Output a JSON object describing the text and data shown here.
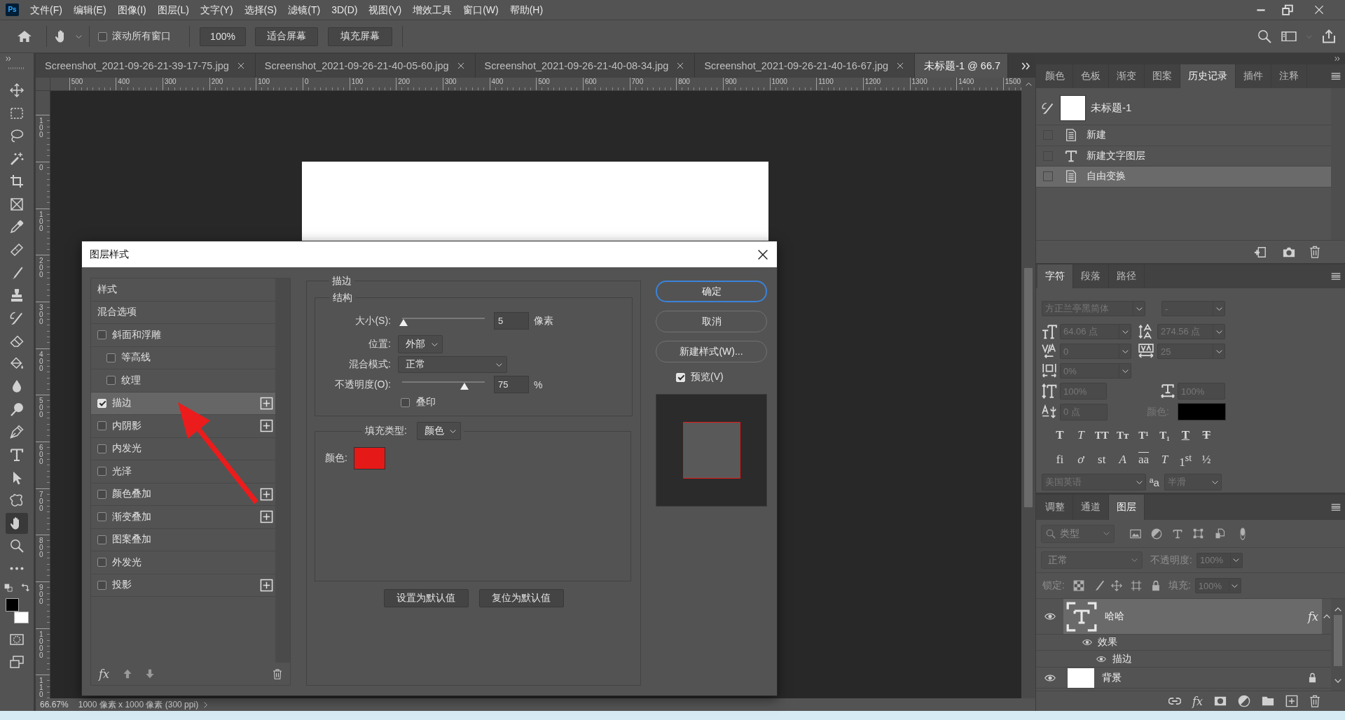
{
  "menu_bar": {
    "logo": "Ps",
    "items": [
      "文件(F)",
      "编辑(E)",
      "图像(I)",
      "图层(L)",
      "文字(Y)",
      "选择(S)",
      "滤镜(T)",
      "3D(D)",
      "视图(V)",
      "增效工具",
      "窗口(W)",
      "帮助(H)"
    ]
  },
  "options_bar": {
    "scroll_all_windows": {
      "label": "滚动所有窗口",
      "checked": false
    },
    "zoom_level": "100%",
    "buttons": [
      "适合屏幕",
      "填充屏幕"
    ]
  },
  "toolbar": {
    "tools": [
      {
        "kind": "move",
        "selected": false
      },
      {
        "kind": "marquee",
        "selected": false
      },
      {
        "kind": "lasso",
        "selected": false
      },
      {
        "kind": "magic_wand",
        "selected": false
      },
      {
        "kind": "crop",
        "selected": false
      },
      {
        "kind": "frame",
        "selected": false
      },
      {
        "kind": "eyedropper",
        "selected": false
      },
      {
        "kind": "healing",
        "selected": false
      },
      {
        "kind": "brush",
        "selected": false
      },
      {
        "kind": "stamp",
        "selected": false
      },
      {
        "kind": "history_brush",
        "selected": false
      },
      {
        "kind": "eraser",
        "selected": false
      },
      {
        "kind": "bucket",
        "selected": false
      },
      {
        "kind": "blur",
        "selected": false
      },
      {
        "kind": "dodge",
        "selected": false
      },
      {
        "kind": "pen",
        "selected": false
      },
      {
        "kind": "type",
        "selected": false
      },
      {
        "kind": "path_select",
        "selected": false
      },
      {
        "kind": "shape",
        "selected": false
      },
      {
        "kind": "hand",
        "selected": true
      },
      {
        "kind": "zoom",
        "selected": false
      },
      {
        "kind": "more",
        "selected": false
      }
    ],
    "color_swatches": [
      {
        "kind": "foreground",
        "color": "#000000"
      },
      {
        "kind": "background",
        "color": "#ffffff"
      }
    ],
    "mode_buttons": [
      {
        "kind": "quick_mask"
      },
      {
        "kind": "screen_mode"
      }
    ]
  },
  "document_tabs": [
    {
      "title": "Screenshot_2021-09-26-21-39-17-75.jpg",
      "selected": false
    },
    {
      "title": "Screenshot_2021-09-26-21-40-05-60.jpg",
      "selected": false
    },
    {
      "title": "Screenshot_2021-09-26-21-40-08-34.jpg",
      "selected": false
    },
    {
      "title": "Screenshot_2021-09-26-21-40-16-67.jpg",
      "selected": false
    },
    {
      "title": "未标题-1 @ 66.7",
      "selected": true
    }
  ],
  "rulers": {
    "horizontal": [
      "500",
      "400",
      "300",
      "200",
      "100",
      "0",
      "100",
      "200",
      "300",
      "400",
      "500",
      "600",
      "700",
      "800",
      "900",
      "1000",
      "1100",
      "1200",
      "1300",
      "1400",
      "1500"
    ],
    "vertical": [
      "100",
      "0",
      "100",
      "200",
      "300",
      "400",
      "500",
      "600",
      "700",
      "800",
      "900",
      "1000",
      "110"
    ]
  },
  "status_bar": {
    "zoom": "66.67%",
    "document_info": "1000 像素 x 1000 像素 (300 ppi)"
  },
  "layer_style_dialog": {
    "title": "图层样式",
    "styles": [
      {
        "label": "样式",
        "kind": "heading",
        "selected": false
      },
      {
        "label": "混合选项",
        "kind": "heading",
        "selected": false
      },
      {
        "label": "斜面和浮雕",
        "kind": "effect",
        "checked": false,
        "selected": false,
        "stackable": false
      },
      {
        "label": "等高线",
        "kind": "sub_effect",
        "checked": false,
        "selected": false,
        "stackable": false
      },
      {
        "label": "纹理",
        "kind": "sub_effect",
        "checked": false,
        "selected": false,
        "stackable": false
      },
      {
        "label": "描边",
        "kind": "effect",
        "checked": true,
        "selected": true,
        "stackable": true
      },
      {
        "label": "内阴影",
        "kind": "effect",
        "checked": false,
        "selected": false,
        "stackable": true
      },
      {
        "label": "内发光",
        "kind": "effect",
        "checked": false,
        "selected": false,
        "stackable": false
      },
      {
        "label": "光泽",
        "kind": "effect",
        "checked": false,
        "selected": false,
        "stackable": false
      },
      {
        "label": "颜色叠加",
        "kind": "effect",
        "checked": false,
        "selected": false,
        "stackable": true
      },
      {
        "label": "渐变叠加",
        "kind": "effect",
        "checked": false,
        "selected": false,
        "stackable": true
      },
      {
        "label": "图案叠加",
        "kind": "effect",
        "checked": false,
        "selected": false,
        "stackable": false
      },
      {
        "label": "外发光",
        "kind": "effect",
        "checked": false,
        "selected": false,
        "stackable": false
      },
      {
        "label": "投影",
        "kind": "effect",
        "checked": false,
        "selected": false,
        "stackable": true
      }
    ],
    "effects_button": "fx",
    "stroke": {
      "title": "描边",
      "structure": {
        "title": "结构",
        "size": {
          "label": "大小(S):",
          "level": 0.02,
          "value": "5",
          "unit": "像素"
        },
        "position": {
          "label": "位置:",
          "value": "外部"
        },
        "blend_mode": {
          "label": "混合模式:",
          "value": "正常"
        },
        "opacity": {
          "label": "不透明度(O):",
          "level": 0.75,
          "value": "75",
          "unit": "%"
        },
        "overprint": {
          "label": "叠印",
          "checked": false
        }
      },
      "fill": {
        "label": "填充类型:",
        "value": "颜色",
        "color_label": "颜色:",
        "color": "#e61919"
      }
    },
    "default_buttons": [
      "设置为默认值",
      "复位为默认值"
    ],
    "buttons": [
      {
        "label": "确定",
        "kind": "primary"
      },
      {
        "label": "取消",
        "kind": "normal"
      },
      {
        "label": "新建样式(W)...",
        "kind": "normal"
      }
    ],
    "preview": {
      "label": "预览(V)",
      "checked": true
    }
  },
  "history_panel": {
    "tabs": [
      {
        "label": "颜色",
        "selected": false
      },
      {
        "label": "色板",
        "selected": false
      },
      {
        "label": "渐变",
        "selected": false
      },
      {
        "label": "图案",
        "selected": false
      },
      {
        "label": "历史记录",
        "selected": true
      },
      {
        "label": "插件",
        "selected": false
      },
      {
        "label": "注释",
        "selected": false
      }
    ],
    "snapshot": {
      "label": "未标题-1"
    },
    "states": [
      {
        "label": "新建",
        "kind": "document",
        "selected": false
      },
      {
        "label": "新建文字图层",
        "kind": "type",
        "selected": false
      },
      {
        "label": "自由变换",
        "kind": "document",
        "selected": true
      }
    ]
  },
  "character_panel": {
    "tabs": [
      {
        "label": "字符",
        "selected": true
      },
      {
        "label": "段落",
        "selected": false
      },
      {
        "label": "路径",
        "selected": false
      }
    ],
    "disabled": true,
    "font_family": "方正兰亭黑简体",
    "font_style": "-",
    "font_size": "64.06 点",
    "leading": "274.56 点",
    "kerning": "0",
    "tracking": "25",
    "character_scale": "0%",
    "vertical_scale": "100%",
    "horizontal_scale": "100%",
    "baseline_shift": "0 点",
    "color_label": "颜色:",
    "color": "#000000",
    "type_styles": [
      {
        "glyph": "T",
        "kind": "bold"
      },
      {
        "glyph": "T",
        "kind": "italic"
      },
      {
        "glyph": "TT",
        "kind": "caps"
      },
      {
        "glyph": "Tт",
        "kind": "small_caps"
      },
      {
        "glyph": "T¹",
        "kind": "superscript"
      },
      {
        "glyph": "T₁",
        "kind": "subscript"
      },
      {
        "glyph": "T",
        "kind": "underline"
      },
      {
        "glyph": "T",
        "kind": "strikethrough"
      }
    ],
    "opentype": [
      {
        "glyph": "fi",
        "kind": "plain"
      },
      {
        "glyph": "ơ",
        "kind": "italic"
      },
      {
        "glyph": "st",
        "kind": "plain"
      },
      {
        "glyph": "A",
        "kind": "italic"
      },
      {
        "glyph": "aa",
        "kind": "overline"
      },
      {
        "glyph": "T",
        "kind": "italic"
      },
      {
        "glyph": "1$^{st}$",
        "kind": "ordinal"
      },
      {
        "glyph": "½",
        "kind": "plain"
      }
    ],
    "language": "美国英语",
    "anti_alias_glyph": "ªa",
    "anti_alias": "半滑"
  },
  "layers_panel": {
    "tabs": [
      {
        "label": "调整",
        "selected": false
      },
      {
        "label": "通道",
        "selected": false
      },
      {
        "label": "图层",
        "selected": true
      }
    ],
    "filter": "类型",
    "blend_mode": "正常",
    "opacity_label": "不透明度:",
    "opacity": "100%",
    "lock_label": "锁定:",
    "fill_label": "填充:",
    "fill": "100%",
    "layers": [
      {
        "name": "哈哈",
        "kind": "type",
        "selected": true,
        "visible": true,
        "locked": false,
        "effects_badge": "fx",
        "expanded": true,
        "children": [
          {
            "name": "效果",
            "visible": true,
            "children": [
              {
                "name": "描边",
                "visible": true
              }
            ]
          }
        ]
      },
      {
        "name": "背景",
        "kind": "background",
        "selected": false,
        "visible": true,
        "locked": true
      }
    ],
    "footer_fx": "fx"
  }
}
